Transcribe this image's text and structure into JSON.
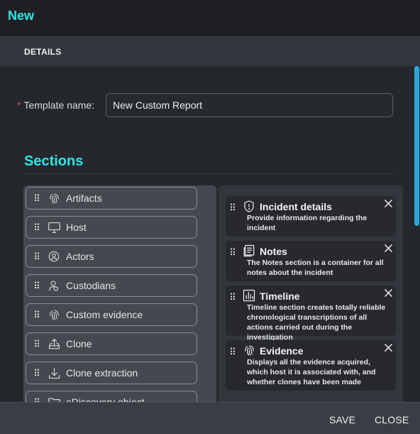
{
  "dialog": {
    "title": "New"
  },
  "tabs": [
    {
      "label": "DETAILS"
    }
  ],
  "template": {
    "label": "Template name:",
    "required_marker": "*",
    "value": "New Custom Report"
  },
  "sections": {
    "title": "Sections",
    "available": [
      {
        "label": "Artifacts",
        "icon": "fingerprint-icon"
      },
      {
        "label": "Host",
        "icon": "monitor-icon"
      },
      {
        "label": "Actors",
        "icon": "actor-icon"
      },
      {
        "label": "Custodians",
        "icon": "custodian-icon"
      },
      {
        "label": "Custom evidence",
        "icon": "fingerprint-icon"
      },
      {
        "label": "Clone",
        "icon": "upload-tray-icon"
      },
      {
        "label": "Clone extraction",
        "icon": "download-icon"
      },
      {
        "label": "eDiscovery object",
        "icon": "folder-icon"
      }
    ],
    "selected": [
      {
        "name": "Incident details",
        "icon": "shield-alert-icon",
        "description": "Provide information regarding the incident"
      },
      {
        "name": "Notes",
        "icon": "notes-icon",
        "description": "The Notes section is a container for all notes about the incident"
      },
      {
        "name": "Timeline",
        "icon": "bar-chart-icon",
        "description": "Timeline section creates totally reliable chronological transcriptions of all actions carried out during the investigation"
      },
      {
        "name": "Evidence",
        "icon": "fingerprint-icon",
        "description": "Displays all the evidence acquired, which host it is associated with, and whether clones have been made"
      }
    ]
  },
  "footer": {
    "save_label": "SAVE",
    "close_label": "CLOSE"
  },
  "colors": {
    "accent": "#2ee6e6",
    "scrollbar": "#2ba8d8",
    "required": "#e05050"
  }
}
